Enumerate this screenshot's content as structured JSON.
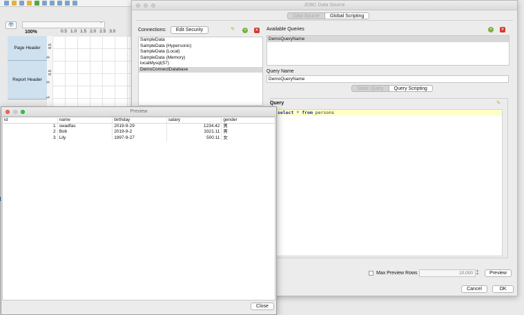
{
  "designer": {
    "zoom": "100%",
    "ruler_ticks": [
      "0.5",
      "1.0",
      "1.5",
      "2.0",
      "2.5",
      "3.0"
    ],
    "vertical_ruler_ticks": [
      "0.5",
      "0",
      "0.5",
      "0",
      "5"
    ],
    "bands": [
      "Page Header",
      "Report Header"
    ]
  },
  "jdbc": {
    "title": "JDBC Data Source",
    "tabs": [
      "Data Source",
      "Global Scripting"
    ],
    "connections_label": "Connections:",
    "edit_security": "Edit Security",
    "connections": [
      "SampleData",
      "SampleData (Hypersonic)",
      "SampleData (Local)",
      "SampleData (Memory)",
      "localMysql(57)",
      "DemoConnectDatabase"
    ],
    "selected_connection": 5,
    "available_queries_label": "Available Queries",
    "queries": [
      "DemoQueryName"
    ],
    "query_name_label": "Query Name",
    "query_name_value": "DemoQueryName",
    "query_tabs": [
      "Static Query",
      "Query Scripting"
    ],
    "query_label": "Query",
    "query_sql": {
      "kw1": "select",
      "star": " * ",
      "kw2": "from",
      "table": " persons"
    },
    "max_preview_rows_label": "Max Preview Rows",
    "max_preview_rows_value": "10,000",
    "preview_button": "Preview",
    "cancel_button": "Cancel",
    "ok_button": "OK"
  },
  "preview": {
    "title": "Preview",
    "columns": [
      "id",
      "name",
      "birthday",
      "salary",
      "gender"
    ],
    "rows": [
      {
        "id": "1",
        "name": "swadfas",
        "birthday": "2019-9-29",
        "salary": "1234.42",
        "gender": "男"
      },
      {
        "id": "2",
        "name": "Bob",
        "birthday": "2019-9-2",
        "salary": "3321.11",
        "gender": "男"
      },
      {
        "id": "3",
        "name": "Lily",
        "birthday": "1997-9-27",
        "salary": "500.11",
        "gender": "女"
      }
    ],
    "close_button": "Close"
  },
  "colors": {
    "accent_red": "#d23a2f",
    "accent_green": "#7bb13c",
    "query_highlight": "#ffffc8",
    "sql_keyword": "#1d2ba3"
  }
}
